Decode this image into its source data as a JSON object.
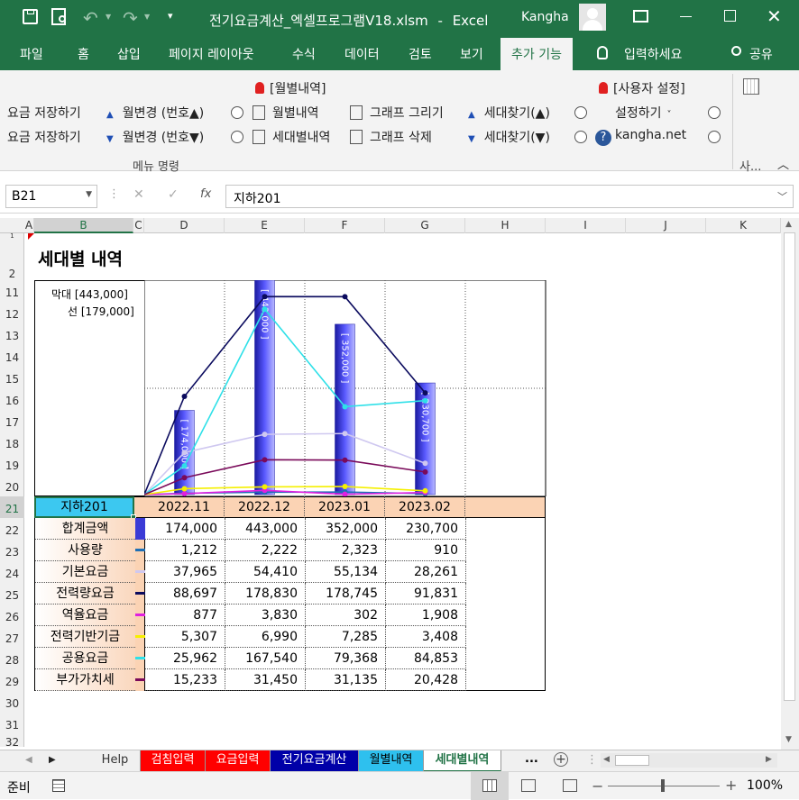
{
  "title_bar": {
    "file_title": "전기요금계산_엑셀프로그램V18.xlsm",
    "separator": "-",
    "app_name": "Excel",
    "user": "Kangha"
  },
  "ribbon_tabs": [
    "파일",
    "홈",
    "삽입",
    "페이지 레이아웃",
    "수식",
    "데이터",
    "검토",
    "보기",
    "추가 기능"
  ],
  "ribbon_active_tab": "추가 기능",
  "tell_me": "입력하세요",
  "share": "공유",
  "ribbon": {
    "save1": "요금 저장하기",
    "save2": "요금 저장하기",
    "month_up": "월변경 (번호▲)",
    "month_down": "월변경 (번호▼)",
    "monthly_group": "[월별내역]",
    "monthly": "월별내역",
    "household": "세대별내역",
    "draw_graph": "그래프 그리기",
    "delete_graph": "그래프 삭제",
    "find_up": "세대찾기(▲)",
    "find_down": "세대찾기(▼)",
    "user_settings_group": "[사용자 설정]",
    "settings": "설정하기",
    "website": "kangha.net",
    "group_label": "메뉴 명령",
    "last_group_label": "사..."
  },
  "formula_bar": {
    "name_box": "B21",
    "fx": "fx",
    "formula": "지하201"
  },
  "columns": [
    "A",
    "B",
    "C",
    "D",
    "E",
    "F",
    "G",
    "H",
    "I",
    "J",
    "K"
  ],
  "rows": [
    "1",
    "2",
    "11",
    "12",
    "13",
    "14",
    "15",
    "16",
    "17",
    "18",
    "19",
    "20",
    "21",
    "22",
    "23",
    "24",
    "25",
    "26",
    "27",
    "28",
    "29",
    "30",
    "31",
    "32"
  ],
  "sheet": {
    "heading": "세대별 내역",
    "legend_bar": "막대 [443,000]",
    "legend_line": "선 [179,000]",
    "selected_cell": "지하201",
    "months": [
      "2022.11",
      "2022.12",
      "2023.01",
      "2023.02"
    ],
    "table": [
      {
        "label": "합계금액",
        "values": [
          "174,000",
          "443,000",
          "352,000",
          "230,700"
        ],
        "color": "#3b3bd6"
      },
      {
        "label": "사용량",
        "values": [
          "1,212",
          "2,222",
          "2,323",
          "910"
        ],
        "color": "#1f6fb5"
      },
      {
        "label": "기본요금",
        "values": [
          "37,965",
          "54,410",
          "55,134",
          "28,261"
        ],
        "color": "#cfc8f0"
      },
      {
        "label": "전력량요금",
        "values": [
          "88,697",
          "178,830",
          "178,745",
          "91,831"
        ],
        "color": "#0b0b5e"
      },
      {
        "label": "역율요금",
        "values": [
          "877",
          "3,830",
          "302",
          "1,908"
        ],
        "color": "#e020e0"
      },
      {
        "label": "전력기반기금",
        "values": [
          "5,307",
          "6,990",
          "7,285",
          "3,408"
        ],
        "color": "#f5f000"
      },
      {
        "label": "공용요금",
        "values": [
          "25,962",
          "167,540",
          "79,368",
          "84,853"
        ],
        "color": "#2ee0e8"
      },
      {
        "label": "부가가치세",
        "values": [
          "15,233",
          "31,450",
          "31,135",
          "20,428"
        ],
        "color": "#7a0a5a"
      }
    ]
  },
  "chart_data": {
    "type": "bar",
    "categories": [
      "2022.11",
      "2022.12",
      "2023.01",
      "2023.02"
    ],
    "bar_series": {
      "name": "합계금액",
      "values": [
        174000,
        443000,
        352000,
        230700
      ],
      "labels": [
        "[ 174,000 ]",
        "[ 443,000 ]",
        "[ 352,000 ]",
        "[ 230,700 ]"
      ]
    },
    "bar_max": 443000,
    "line_max": 179000,
    "line_series": [
      {
        "name": "사용량",
        "values": [
          1212,
          2222,
          2323,
          910
        ],
        "color": "#1f6fb5"
      },
      {
        "name": "기본요금",
        "values": [
          37965,
          54410,
          55134,
          28261
        ],
        "color": "#cfc8f0"
      },
      {
        "name": "전력량요금",
        "values": [
          88697,
          178830,
          178745,
          91831
        ],
        "color": "#0b0b5e"
      },
      {
        "name": "역율요금",
        "values": [
          877,
          3830,
          302,
          1908
        ],
        "color": "#e020e0"
      },
      {
        "name": "전력기반기금",
        "values": [
          5307,
          6990,
          7285,
          3408
        ],
        "color": "#f5f000"
      },
      {
        "name": "공용요금",
        "values": [
          25962,
          167540,
          79368,
          84853
        ],
        "color": "#2ee0e8"
      },
      {
        "name": "부가가치세",
        "values": [
          15233,
          31450,
          31135,
          20428
        ],
        "color": "#7a0a5a"
      }
    ],
    "legend": "top-left"
  },
  "sheet_tabs": [
    {
      "label": "Help",
      "bg": "#f0f0f0",
      "fg": "#333"
    },
    {
      "label": "검침입력",
      "bg": "#ff0000",
      "fg": "#fff"
    },
    {
      "label": "요금입력",
      "bg": "#ff0000",
      "fg": "#fff"
    },
    {
      "label": "전기요금계산",
      "bg": "#0000a8",
      "fg": "#fff"
    },
    {
      "label": "월별내역",
      "bg": "#2ec0ee",
      "fg": "#000"
    },
    {
      "label": "세대별내역",
      "bg": "#ffffff",
      "fg": "#217346"
    }
  ],
  "more_tabs": "...",
  "status": {
    "ready": "준비",
    "zoom": "100%"
  }
}
